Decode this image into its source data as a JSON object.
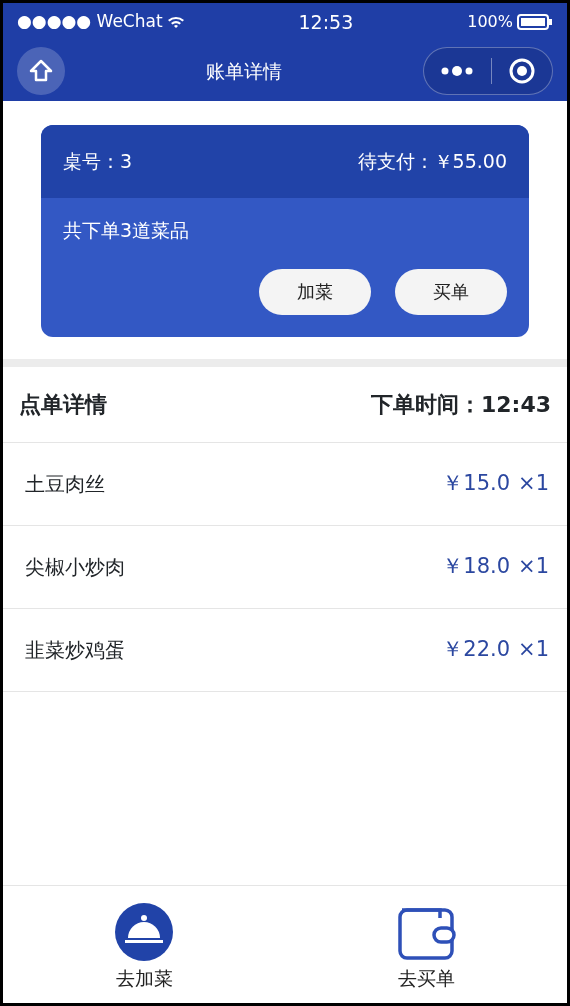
{
  "status_bar": {
    "carrier": "●●●●● WeChat",
    "time": "12:53",
    "battery": "100%"
  },
  "nav_bar": {
    "title": "账单详情"
  },
  "bill_card": {
    "table_label": "桌号：3",
    "amount_due": "待支付：￥55.00",
    "summary": "共下单3道菜品",
    "buttons": [
      {
        "label": "加菜"
      },
      {
        "label": "买单"
      }
    ]
  },
  "order_header": {
    "title": "点单详情",
    "time": "下单时间：12:43"
  },
  "items": [
    {
      "name": "土豆肉丝",
      "price": "￥15.0",
      "qty": "×1"
    },
    {
      "name": "尖椒小炒肉",
      "price": "￥18.0",
      "qty": "×1"
    },
    {
      "name": "韭菜炒鸡蛋",
      "price": "￥22.0",
      "qty": "×1"
    }
  ],
  "tab_bar": [
    {
      "kind": "dish",
      "label": "去加菜"
    },
    {
      "kind": "wallet",
      "label": "去买单"
    }
  ]
}
